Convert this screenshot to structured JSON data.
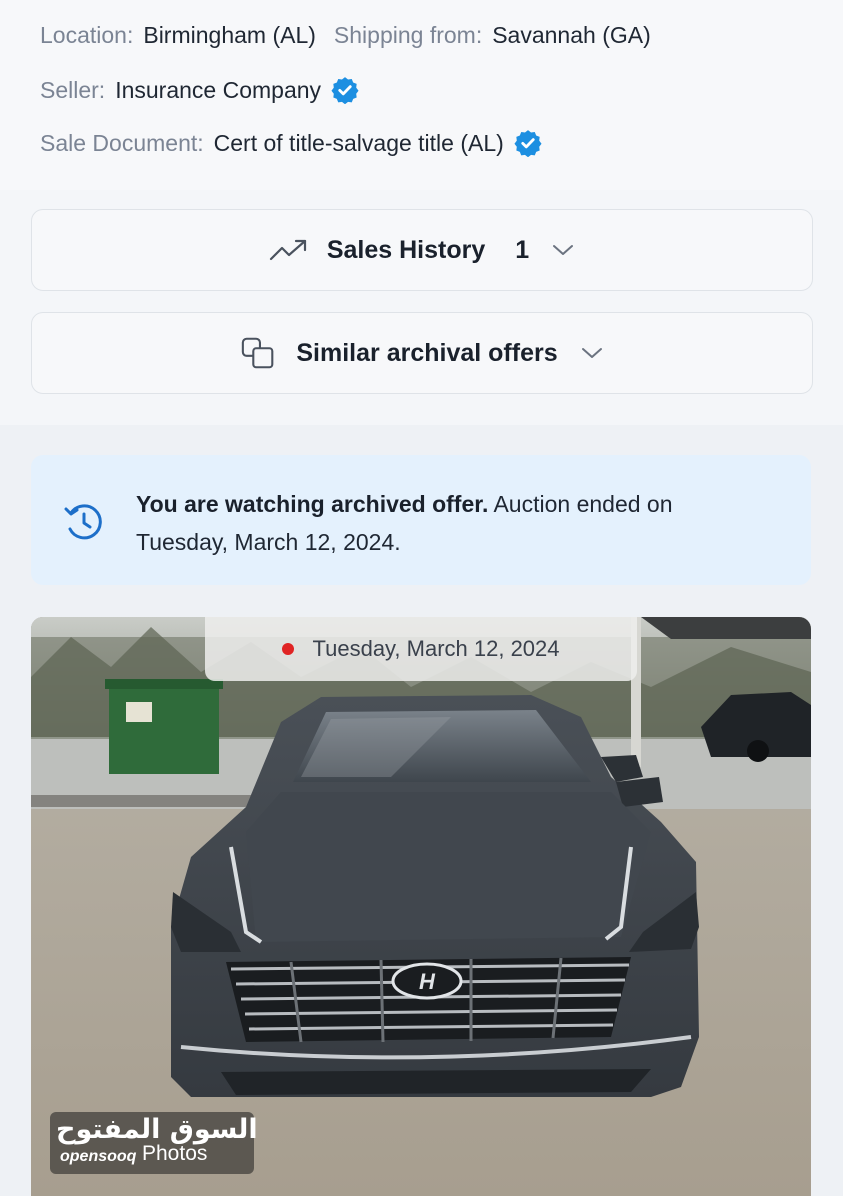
{
  "info": {
    "location_label": "Location:",
    "location_value": "Birmingham (AL)",
    "shipping_label": "Shipping from:",
    "shipping_value": "Savannah (GA)",
    "seller_label": "Seller:",
    "seller_value": "Insurance Company",
    "doc_label": "Sale Document:",
    "doc_value": "Cert of title-salvage title (AL)",
    "verified_icon": "verified-badge-icon",
    "verified_color": "#1d8fe1"
  },
  "sales_history": {
    "title": "Sales History",
    "count": "1",
    "icon": "trend-up-icon"
  },
  "similar": {
    "title": "Similar archival offers",
    "icon": "copy-icon"
  },
  "notice": {
    "bold": "You are watching archived offer.",
    "rest": " Auction ended on Tuesday, March 12, 2024.",
    "icon": "history-icon",
    "bg": "#e4f1fd"
  },
  "photo": {
    "date": "Tuesday, March 12, 2024",
    "status_color": "#e02424",
    "watermark_arabic": "السوق المفتوح",
    "watermark_brand": "opensooq",
    "watermark_photos": "Photos"
  }
}
